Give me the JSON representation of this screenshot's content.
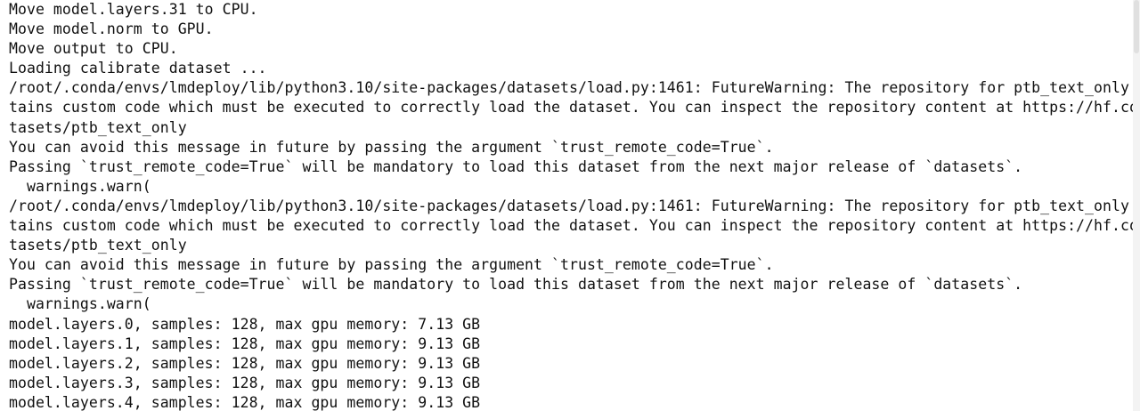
{
  "terminal": {
    "lines": [
      "Move model.layers.31 to CPU.",
      "Move model.norm to GPU.",
      "Move output to CPU.",
      "Loading calibrate dataset ...",
      "/root/.conda/envs/lmdeploy/lib/python3.10/site-packages/datasets/load.py:1461: FutureWarning: The repository for ptb_text_only con",
      "tains custom code which must be executed to correctly load the dataset. You can inspect the repository content at https://hf.co/da",
      "tasets/ptb_text_only",
      "You can avoid this message in future by passing the argument `trust_remote_code=True`.",
      "Passing `trust_remote_code=True` will be mandatory to load this dataset from the next major release of `datasets`.",
      "  warnings.warn(",
      "/root/.conda/envs/lmdeploy/lib/python3.10/site-packages/datasets/load.py:1461: FutureWarning: The repository for ptb_text_only con",
      "tains custom code which must be executed to correctly load the dataset. You can inspect the repository content at https://hf.co/da",
      "tasets/ptb_text_only",
      "You can avoid this message in future by passing the argument `trust_remote_code=True`.",
      "Passing `trust_remote_code=True` will be mandatory to load this dataset from the next major release of `datasets`.",
      "  warnings.warn(",
      "model.layers.0, samples: 128, max gpu memory: 7.13 GB",
      "model.layers.1, samples: 128, max gpu memory: 9.13 GB",
      "model.layers.2, samples: 128, max gpu memory: 9.13 GB",
      "model.layers.3, samples: 128, max gpu memory: 9.13 GB",
      "model.layers.4, samples: 128, max gpu memory: 9.13 GB"
    ]
  }
}
